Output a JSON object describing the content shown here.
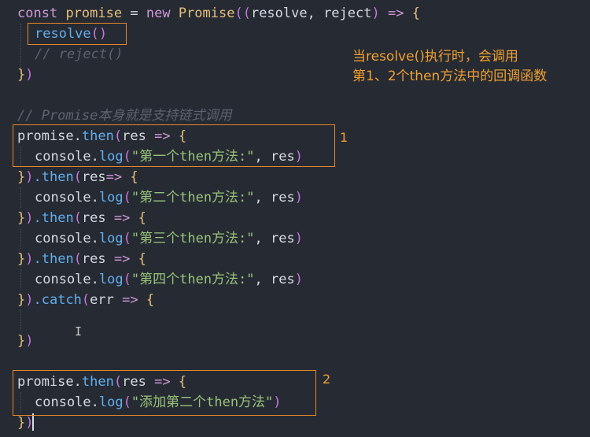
{
  "code": {
    "l1": {
      "a": "const",
      "b": "promise",
      "c": "=",
      "d": "new",
      "e": "Promise",
      "f": "((",
      "g": "resolve, reject",
      "h": ")",
      "i": "=>",
      "j": "{"
    },
    "l2": {
      "a": "resolve",
      "b": "()"
    },
    "l3": {
      "a": "// reject()"
    },
    "l4": {
      "a": "}",
      "b": ")"
    },
    "l5": {
      "a": "// Promise本身就是支持链式调用"
    },
    "l6": {
      "a": "promise",
      "b": ".",
      "c": "then",
      "d": "(",
      "e": "res",
      "f": "=>",
      "g": "{"
    },
    "l7": {
      "a": "console",
      "b": ".",
      "c": "log",
      "d": "(",
      "e": "\"第一个then方法:\"",
      "f": ", res",
      "g": ")"
    },
    "l8": {
      "a": "}",
      "b": ")",
      "c": ".then",
      "d": "(",
      "e": "res",
      "f": "=>",
      "g": "{"
    },
    "l9": {
      "a": "console",
      "b": ".",
      "c": "log",
      "d": "(",
      "e": "\"第二个then方法:\"",
      "f": ", res",
      "g": ")"
    },
    "l10": {
      "a": "}",
      "b": ")",
      "c": ".then",
      "d": "(",
      "e": "res",
      "f": "=>",
      "g": "{"
    },
    "l11": {
      "a": "console",
      "b": ".",
      "c": "log",
      "d": "(",
      "e": "\"第三个then方法:\"",
      "f": ", res",
      "g": ")"
    },
    "l12": {
      "a": "}",
      "b": ")",
      "c": ".then",
      "d": "(",
      "e": "res",
      "f": "=>",
      "g": "{"
    },
    "l13": {
      "a": "console",
      "b": ".",
      "c": "log",
      "d": "(",
      "e": "\"第四个then方法:\"",
      "f": ", res",
      "g": ")"
    },
    "l14": {
      "a": "}",
      "b": ")",
      "c": ".catch",
      "d": "(",
      "e": "err",
      "f": "=>",
      "g": "{"
    },
    "l15": {
      "a": "}",
      "b": ")"
    },
    "l16": {
      "a": "promise",
      "b": ".",
      "c": "then",
      "d": "(",
      "e": "res",
      "f": "=>",
      "g": "{"
    },
    "l17": {
      "a": "console",
      "b": ".",
      "c": "log",
      "d": "(",
      "e": "\"添加第二个then方法\"",
      "g": ")"
    },
    "l18": {
      "a": "}",
      "b": ")"
    }
  },
  "annotations": {
    "note_line1": "当resolve()执行时，会调用",
    "note_line2": "第1、2个then方法中的回调函数",
    "label_1": "1",
    "label_2": "2"
  },
  "colors": {
    "background": "#262a33",
    "annotation": "#e8872a"
  }
}
